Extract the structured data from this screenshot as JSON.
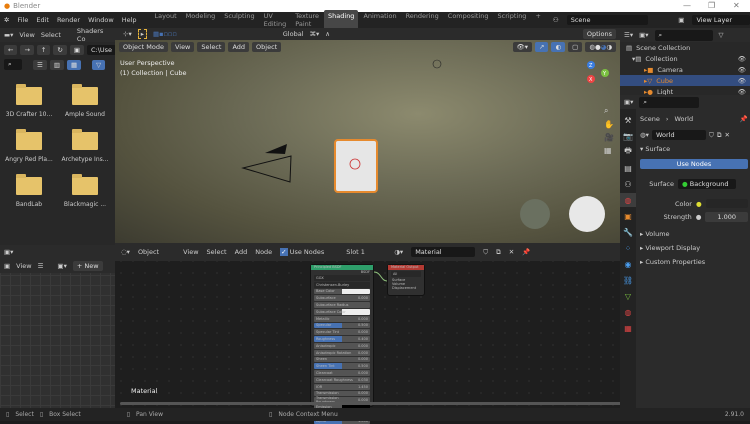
{
  "window": {
    "title": "Blender",
    "minimize": "—",
    "maximize": "❐",
    "close": "✕"
  },
  "menu": [
    "File",
    "Edit",
    "Render",
    "Window",
    "Help"
  ],
  "workspaces": [
    "Layout",
    "Modeling",
    "Sculpting",
    "UV Editing",
    "Texture Paint",
    "Shading",
    "Animation",
    "Rendering",
    "Compositing",
    "Scripting"
  ],
  "active_workspace": "Shading",
  "add_workspace": "+",
  "scene": "Scene",
  "view_layer": "View Layer",
  "file_browser": {
    "menu": [
      "View",
      "Select"
    ],
    "editor": "Shaders Co",
    "path": "C:\\Use",
    "items": [
      "3D Crafter 10...",
      "Ample Sound",
      "Angry Red Pla...",
      "Archetype Ins...",
      "BandLab",
      "Blackmagic ..."
    ]
  },
  "image_editor": {
    "view": "View",
    "new": "New"
  },
  "viewport": {
    "mode": "Object Mode",
    "menu": [
      "View",
      "Select",
      "Add",
      "Object"
    ],
    "transform": "Global",
    "options": "Options",
    "perspective": "User Perspective",
    "collection_info": "(1) Collection | Cube",
    "gizmo": {
      "x": "X",
      "y": "Y",
      "z": "Z"
    }
  },
  "node_editor": {
    "type": "Object",
    "menu": [
      "View",
      "Select",
      "Add",
      "Node"
    ],
    "use_nodes": "Use Nodes",
    "slot": "Slot 1",
    "material": "Material",
    "label": "Material",
    "bsdf": {
      "title": "Principled BSDF",
      "output": "BSDF",
      "dist": "GGX",
      "sss": "Christensen-Burley",
      "rows": [
        [
          "Base Color",
          ""
        ],
        [
          "Subsurface",
          "0.000"
        ],
        [
          "Subsurface Radius",
          ""
        ],
        [
          "Subsurface Color",
          ""
        ],
        [
          "Metallic",
          "0.000"
        ],
        [
          "Specular",
          "0.500"
        ],
        [
          "Specular Tint",
          "0.000"
        ],
        [
          "Roughness",
          "0.400"
        ],
        [
          "Anisotropic",
          "0.000"
        ],
        [
          "Anisotropic Rotation",
          "0.000"
        ],
        [
          "Sheen",
          "0.000"
        ],
        [
          "Sheen Tint",
          "0.500"
        ],
        [
          "Clearcoat",
          "0.000"
        ],
        [
          "Clearcoat Roughness",
          "0.030"
        ],
        [
          "IOR",
          "1.450"
        ],
        [
          "Transmission",
          "0.000"
        ],
        [
          "Transmission Roughness",
          "0.000"
        ],
        [
          "Emission",
          ""
        ],
        [
          "Emission Strength",
          "1.000"
        ],
        [
          "Alpha",
          "1.000"
        ]
      ]
    },
    "output": {
      "title": "Material Output",
      "target": "All",
      "inputs": [
        "Surface",
        "Volume",
        "Displacement"
      ]
    }
  },
  "outliner": {
    "items": [
      {
        "label": "Scene Collection",
        "depth": 0
      },
      {
        "label": "Collection",
        "depth": 1
      },
      {
        "label": "Camera",
        "depth": 2
      },
      {
        "label": "Cube",
        "depth": 2,
        "selected": true
      },
      {
        "label": "Light",
        "depth": 2
      }
    ]
  },
  "properties": {
    "breadcrumb": [
      "Scene",
      "World"
    ],
    "world": "World",
    "surface_panel": "Surface",
    "use_nodes": "Use Nodes",
    "surface_label": "Surface",
    "surface_value": "Background",
    "color_label": "Color",
    "strength_label": "Strength",
    "strength": "1.000",
    "panels": [
      "Volume",
      "Viewport Display",
      "Custom Properties"
    ]
  },
  "status": {
    "items": [
      "Select",
      "Box Select",
      "Pan View",
      "Node Context Menu"
    ],
    "version": "2.91.0"
  },
  "colors": {
    "accent": "#4772b3",
    "selection": "#e68a2e",
    "folder": "#e6c36a",
    "bsdf_header": "#2e9e6a",
    "output_header": "#b33a33"
  }
}
